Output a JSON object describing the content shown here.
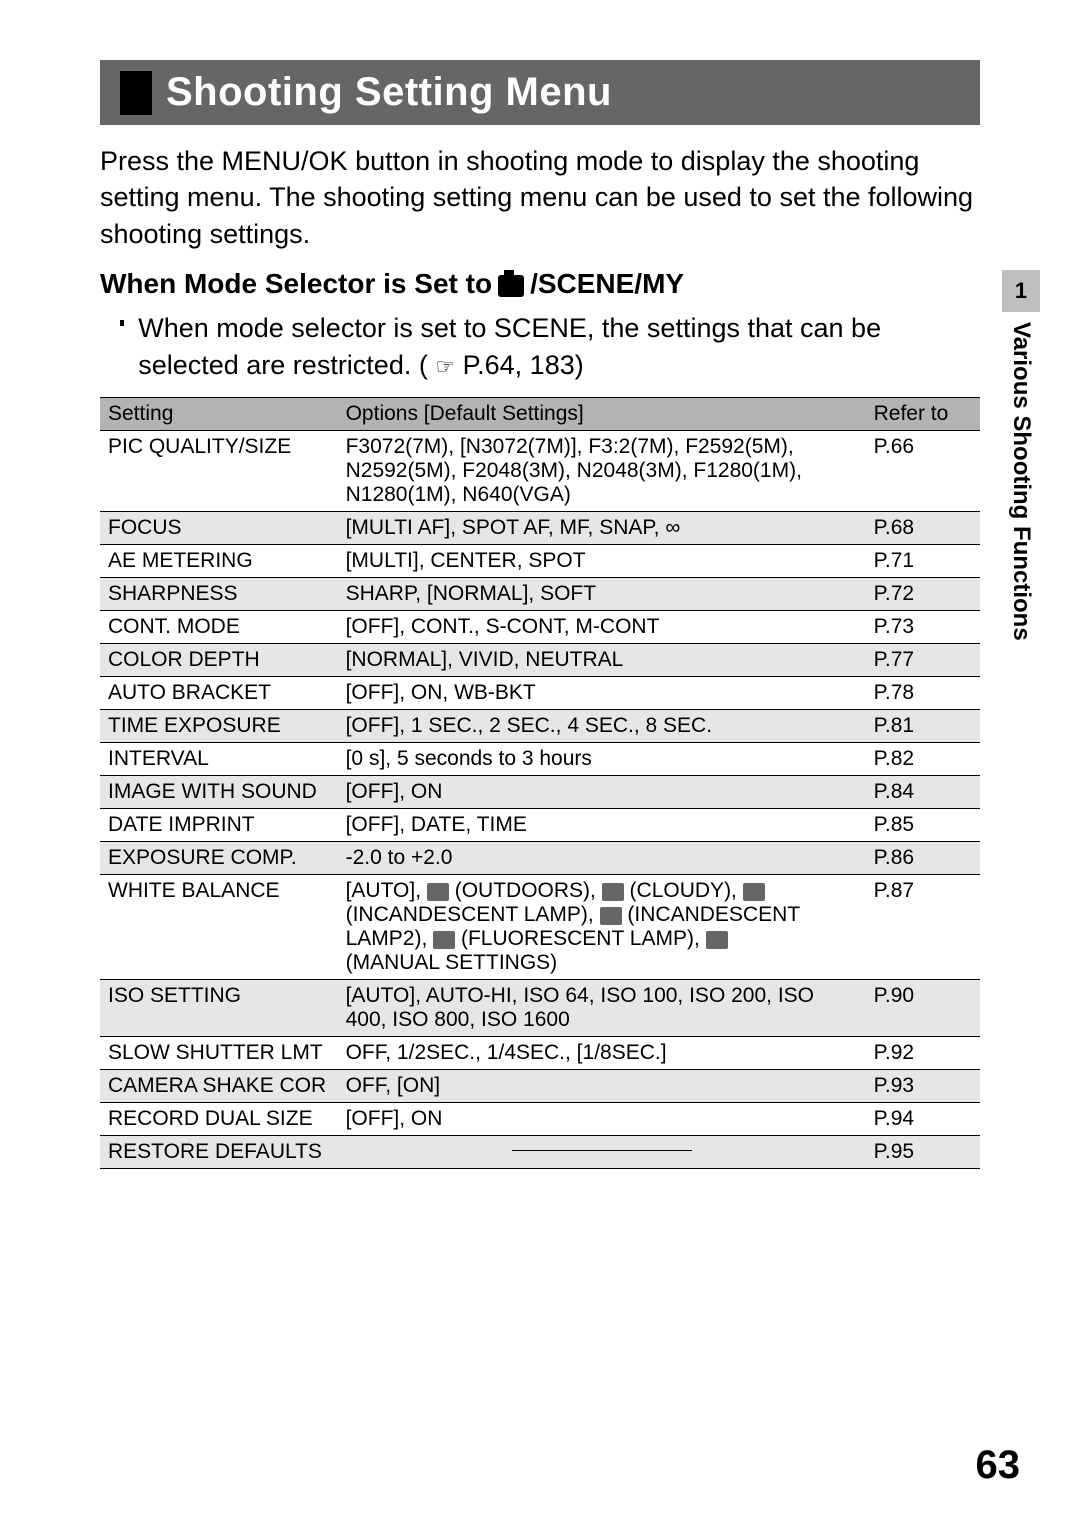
{
  "title": "Shooting Setting Menu",
  "intro": "Press the MENU/OK button in shooting mode to display the shooting setting menu. The shooting setting menu can be used to set the following shooting settings.",
  "subhead_prefix": "When Mode Selector is Set to ",
  "subhead_suffix": "/SCENE/MY",
  "bullet": "When mode selector is set to SCENE, the settings that can be selected are restricted. (",
  "bullet_ref": "P.64, 183)",
  "headers": {
    "c1": "Setting",
    "c2": "Options [Default Settings]",
    "c3": "Refer to"
  },
  "rows": [
    {
      "shade": false,
      "setting": "PIC QUALITY/SIZE",
      "options": "F3072(7M), [N3072(7M)], F3:2(7M), F2592(5M), N2592(5M), F2048(3M), N2048(3M), F1280(1M), N1280(1M), N640(VGA)",
      "ref": "P.66"
    },
    {
      "shade": true,
      "setting": "FOCUS",
      "options": "[MULTI AF], SPOT AF, MF, SNAP, ∞",
      "ref": "P.68"
    },
    {
      "shade": false,
      "setting": "AE METERING",
      "options": "[MULTI], CENTER, SPOT",
      "ref": "P.71"
    },
    {
      "shade": true,
      "setting": "SHARPNESS",
      "options": "SHARP, [NORMAL], SOFT",
      "ref": "P.72"
    },
    {
      "shade": false,
      "setting": "CONT. MODE",
      "options": "[OFF], CONT., S-CONT, M-CONT",
      "ref": "P.73"
    },
    {
      "shade": true,
      "setting": "COLOR DEPTH",
      "options": "[NORMAL], VIVID, NEUTRAL",
      "ref": "P.77"
    },
    {
      "shade": false,
      "setting": "AUTO BRACKET",
      "options": "[OFF], ON, WB-BKT",
      "ref": "P.78"
    },
    {
      "shade": true,
      "setting": "TIME EXPOSURE",
      "options": "[OFF], 1 SEC., 2 SEC., 4 SEC., 8 SEC.",
      "ref": "P.81"
    },
    {
      "shade": false,
      "setting": "INTERVAL",
      "options": "[0 s], 5 seconds to 3 hours",
      "ref": "P.82"
    },
    {
      "shade": true,
      "setting": "IMAGE WITH SOUND",
      "options": "[OFF], ON",
      "ref": "P.84"
    },
    {
      "shade": false,
      "setting": "DATE IMPRINT",
      "options": "[OFF], DATE, TIME",
      "ref": "P.85"
    },
    {
      "shade": true,
      "setting": "EXPOSURE COMP.",
      "options": "-2.0 to +2.0",
      "ref": "P.86"
    },
    {
      "shade": false,
      "setting": "WHITE BALANCE",
      "options_rich": true,
      "ref": "P.87"
    },
    {
      "shade": true,
      "setting": "ISO SETTING",
      "options": "[AUTO], AUTO-HI, ISO 64, ISO 100, ISO 200, ISO 400, ISO 800, ISO 1600",
      "ref": "P.90"
    },
    {
      "shade": false,
      "setting": "SLOW SHUTTER LMT",
      "options": "OFF, 1/2SEC., 1/4SEC., [1/8SEC.]",
      "ref": "P.92"
    },
    {
      "shade": true,
      "setting": "CAMERA SHAKE COR",
      "options": "OFF, [ON]",
      "ref": "P.93"
    },
    {
      "shade": false,
      "setting": "RECORD DUAL SIZE",
      "options": "[OFF], ON",
      "ref": "P.94"
    },
    {
      "shade": true,
      "setting": "RESTORE DEFAULTS",
      "options_dash": true,
      "ref": "P.95"
    }
  ],
  "wb": {
    "p1": "[AUTO], ",
    "outdoors": " (OUTDOORS), ",
    "cloudy": " (CLOUDY), ",
    "line2a": "(INCANDESCENT LAMP), ",
    "line2b": " (INCANDESCENT",
    "line3a": "LAMP2), ",
    "line3b": " (FLUORESCENT LAMP), ",
    "line4": "(MANUAL SETTINGS)"
  },
  "sidebar": {
    "num": "1",
    "label": "Various Shooting Functions"
  },
  "page_number": "63"
}
